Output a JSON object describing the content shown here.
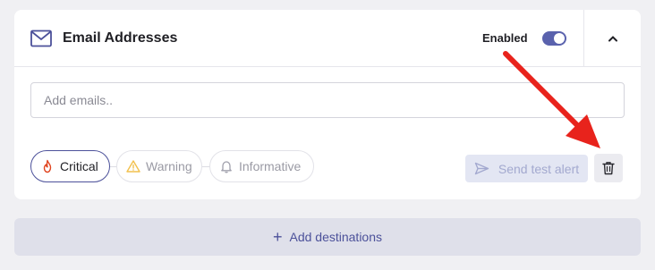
{
  "header": {
    "title": "Email Addresses",
    "title_icon": "envelope-icon",
    "enabled_label": "Enabled",
    "enabled": true,
    "collapse_icon": "chevron-up-icon"
  },
  "email_input": {
    "placeholder": "Add emails..",
    "value": ""
  },
  "severities": [
    {
      "label": "Critical",
      "icon": "flame-icon",
      "selected": true
    },
    {
      "label": "Warning",
      "icon": "warning-triangle-icon",
      "selected": false
    },
    {
      "label": "Informative",
      "icon": "bell-icon",
      "selected": false
    }
  ],
  "actions": {
    "send_test_alert_label": "Send test alert",
    "send_icon": "send-icon",
    "delete_icon": "trash-icon"
  },
  "footer": {
    "add_destinations_label": "Add destinations",
    "add_icon": "plus-icon"
  },
  "colors": {
    "accent": "#4c519a",
    "toggle": "#5a62ad",
    "annotation_arrow": "#e8231c"
  }
}
